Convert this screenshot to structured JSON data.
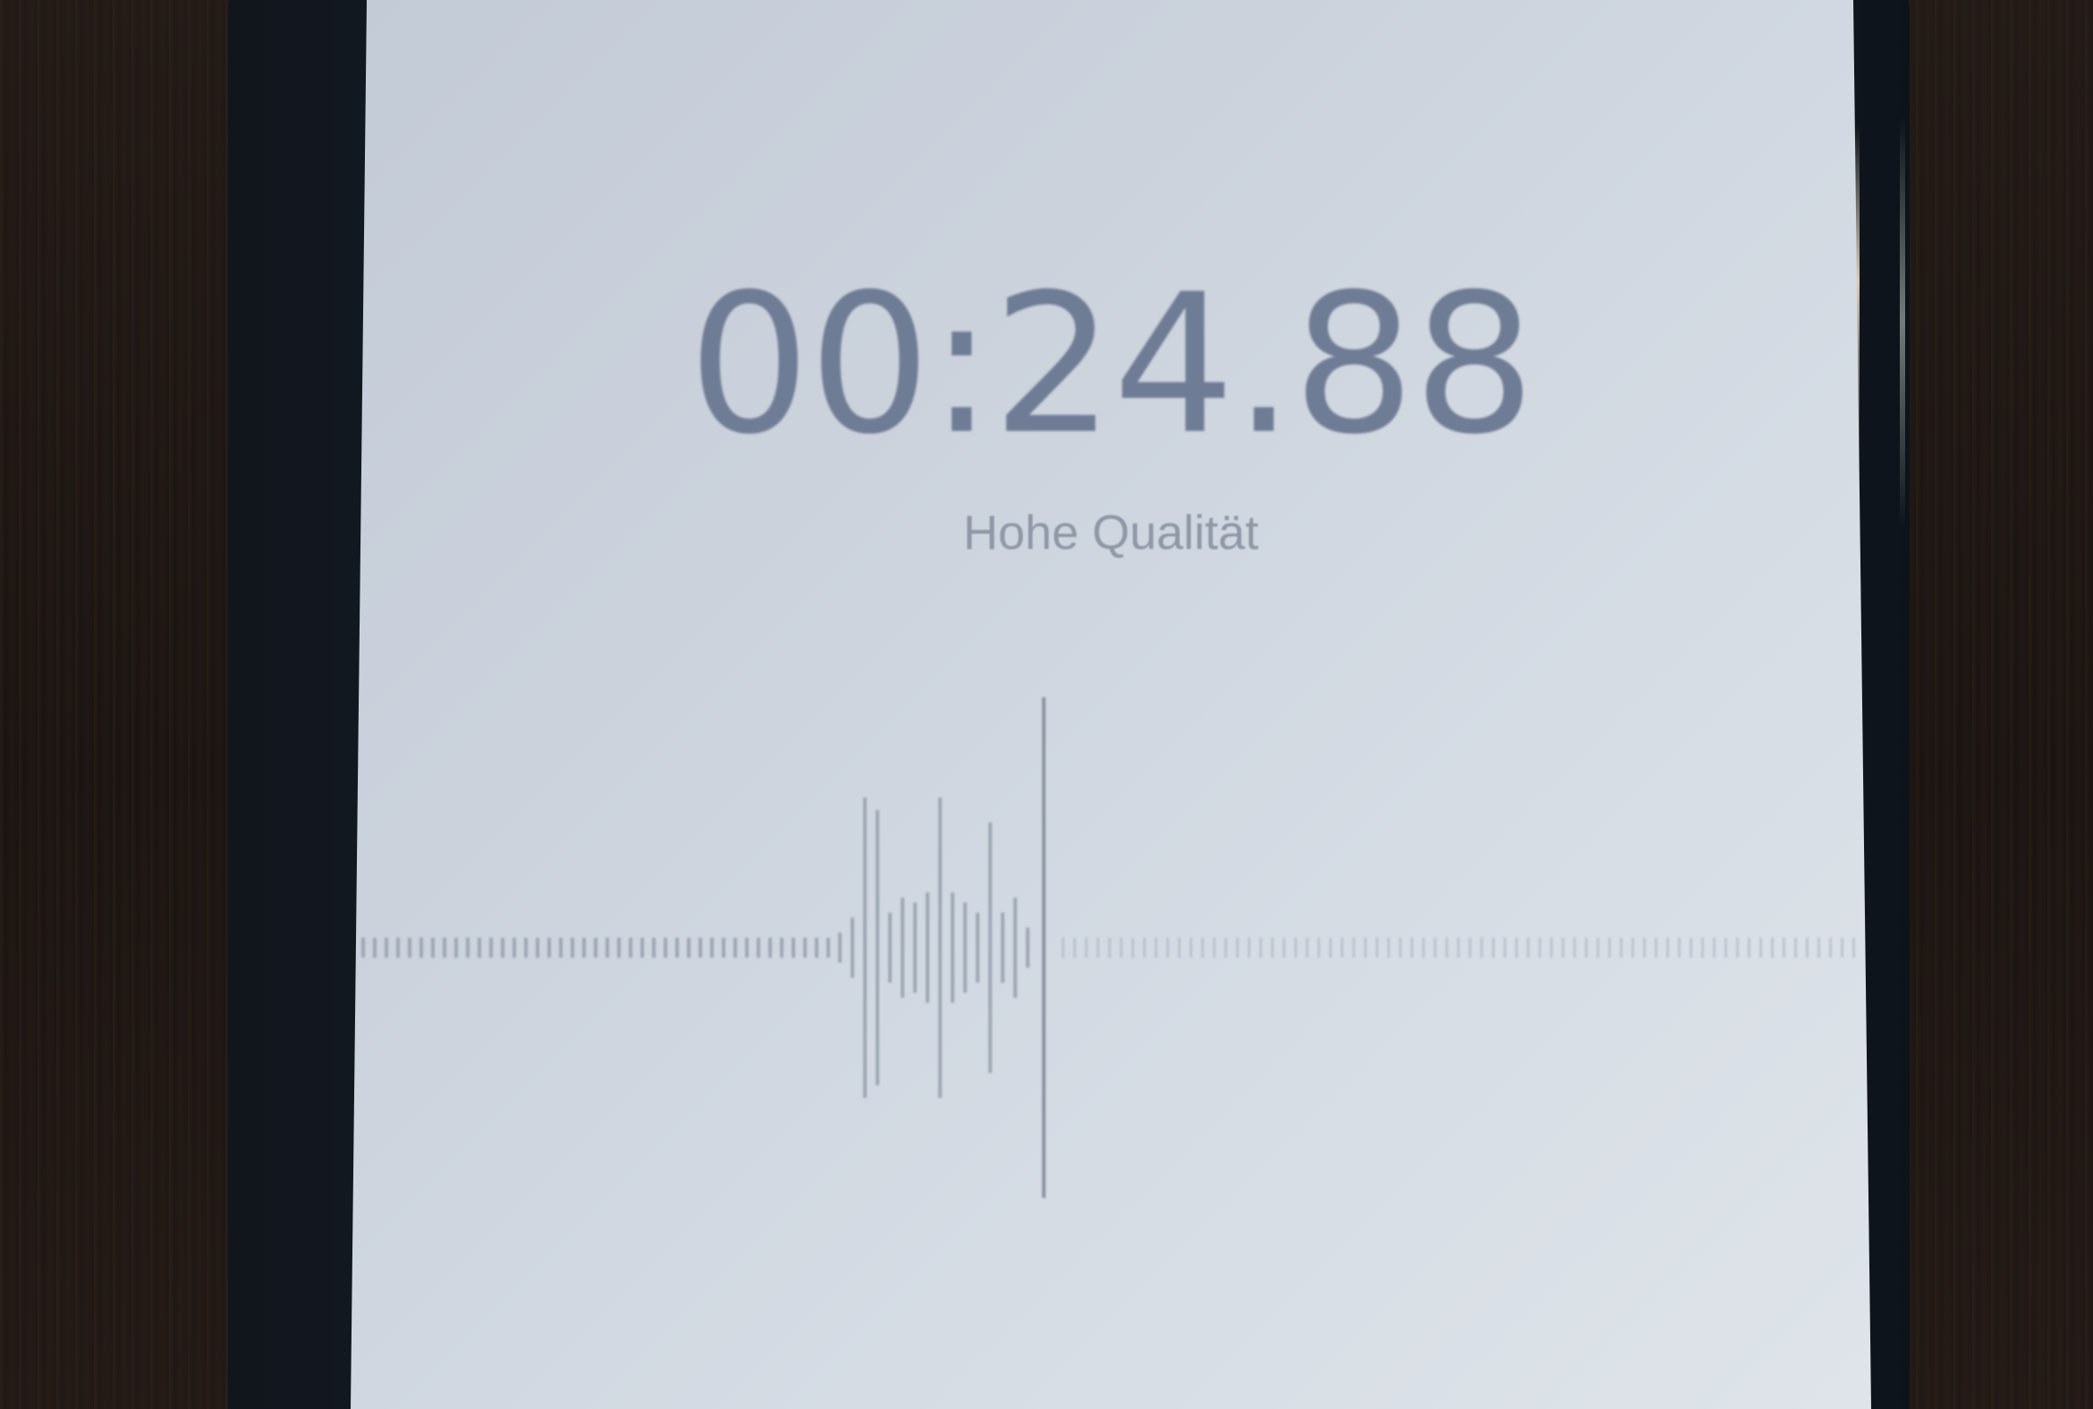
{
  "recorder": {
    "elapsed_time": "00:24.88",
    "quality_label": "Hohe Qualität"
  },
  "colors": {
    "timer_text": "#6f7c95",
    "subtitle_text": "#8f98a7",
    "waveform_bar": "#9ea7b3",
    "playhead": "#8b93a0"
  },
  "waveform": {
    "recorded_levels": [
      0.06,
      0.12,
      0.6,
      0.55,
      0.14,
      0.2,
      0.18,
      0.22,
      0.6,
      0.22,
      0.18,
      0.14,
      0.5,
      0.14,
      0.2,
      0.08
    ],
    "idle_level": 0.04
  }
}
